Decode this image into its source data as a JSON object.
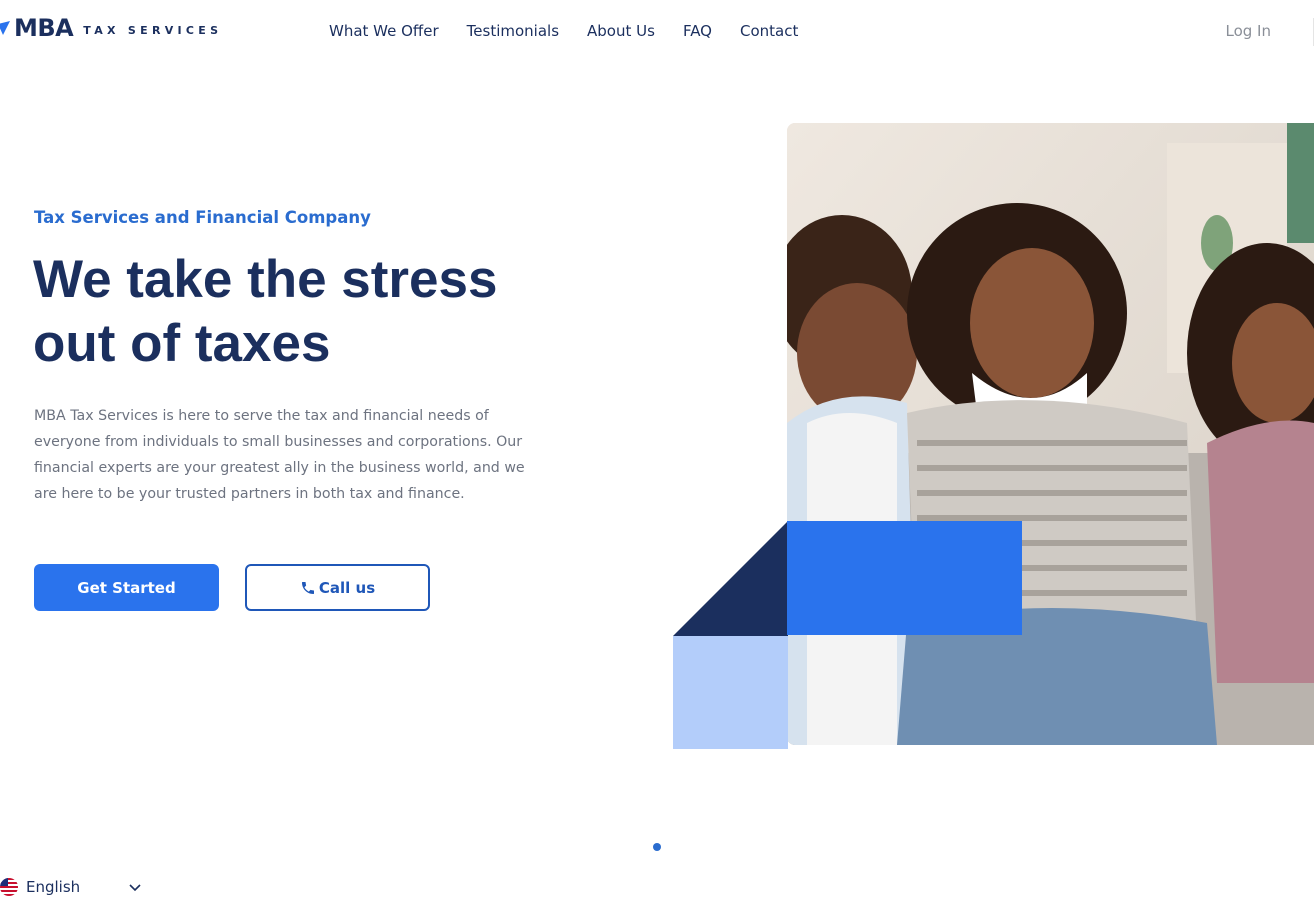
{
  "header": {
    "logo_main": "MBA",
    "logo_sub": "TAX SERVICES",
    "nav": [
      {
        "label": "What We Offer"
      },
      {
        "label": "Testimonials"
      },
      {
        "label": "About Us"
      },
      {
        "label": "FAQ"
      },
      {
        "label": "Contact"
      }
    ],
    "login": "Log In"
  },
  "hero": {
    "kicker": "Tax Services and Financial Company",
    "headline": "We take the stress out of taxes",
    "description": "MBA Tax Services is here to serve the tax and financial needs of everyone from individuals to small businesses and corporations. Our financial experts are your greatest ally in the business world, and we are here to be your trusted partners in both tax and finance.",
    "cta_primary": "Get Started",
    "cta_secondary": "Call us",
    "phone_icon": "phone-icon"
  },
  "carousel": {
    "active_index": 1
  },
  "language": {
    "selected": "English",
    "flag_icon": "us-flag-icon",
    "chevron_icon": "chevron-down-icon"
  },
  "colors": {
    "navy": "#1b2f5e",
    "accent_blue": "#2a73ed",
    "light_blue": "#b3cdfa",
    "kicker_blue": "#2a6ccf"
  }
}
